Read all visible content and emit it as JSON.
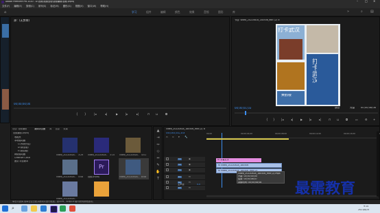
{
  "app": {
    "title": "Adobe Premiere Pro 2020 - D:\\视频\\视频处理\\视频编辑\\视频.prproj",
    "menu": [
      "文件(F)",
      "编辑(E)",
      "剪辑(C)",
      "序列(S)",
      "标记(M)",
      "图形(G)",
      "视图(V)",
      "窗口(W)",
      "帮助(H)"
    ],
    "workspaces": [
      "学习",
      "组件",
      "编辑",
      "颜色",
      "效果",
      "音频",
      "图形",
      "库"
    ],
    "active_workspace": "学习"
  },
  "source_monitor": {
    "tab": "源：(无剪辑)",
    "timecode": "00;00;00;00"
  },
  "program_monitor": {
    "tab": "节目: video_20220818_180506_edit (2) ≡",
    "timecode_left": "00;00;01;03",
    "fit": "适合",
    "quality": "完整",
    "timecode_right": "00;00;08;08",
    "image": {
      "left_text": "打卡武汉",
      "right_text": "打卡武汉",
      "bottom_text": "黄鹤楼"
    }
  },
  "project_panel": {
    "tabs": [
      "项目: 视频编辑",
      "媒体浏览器",
      "库",
      "信息",
      "效果"
    ],
    "path": "视频编辑.prproj",
    "tree": [
      "收藏夹",
      "本地驱动器",
      "C:(系统分区)",
      "D:(新加卷)",
      "E:(新加卷)",
      "网络驱动器",
      "Creative Cloud",
      "团队 项目版本"
    ],
    "items": [
      {
        "label": "video_20220818..",
        "dur": "3:29"
      },
      {
        "label": "video_20220818..",
        "dur": "3:15"
      },
      {
        "label": "video_20220818..",
        "dur": "4:01"
      },
      {
        "label": "video_20220818..",
        "dur": "5:08"
      },
      {
        "label": "视频.prproj",
        "dur": ""
      },
      {
        "label": "video_20220818..",
        "dur": "8:08"
      },
      {
        "label": "video_20220818..",
        "dur": ""
      },
      {
        "label": "",
        "dur": ""
      }
    ]
  },
  "timeline": {
    "tab": "video_20220818_180506_edit (2) ≡",
    "timecode": "00;00;01;03",
    "ruler": [
      "00;00",
      "00;00;04;00",
      "00;00;08;00",
      "00;00;12;00",
      "00;00;16;00",
      "00;00;20;00"
    ],
    "tracks": [
      "V3",
      "V2",
      "V1",
      "A1",
      "A2",
      "A3"
    ],
    "clips": {
      "v3": "fx 字幕文字",
      "v2": "fx video_20220818_180506",
      "v1": "fx video_20220818_180506_edit (2)"
    },
    "tooltip": {
      "name": "video_20220818_180506_edit (2).mp4",
      "start": "开始: 00;00;00;00",
      "end": "结束: 00;00;08;07",
      "duration": "持续时间: 00;00;08;08"
    },
    "master": "主声道",
    "master_value": "0.0"
  },
  "status_bar": "单击以选择,或单击空白处并拖动以进行框选。按Shift、Alt和Ctrl键可获得其他选项。",
  "watermark": "最需教育",
  "taskbar": {
    "time": "9:14",
    "date": "2021/8/24",
    "colors": {
      "bg": "#dbe6f1"
    }
  },
  "colors": {
    "accent": "#3d8ef0",
    "pink_clip": "#e58ee0",
    "blue_clip": "#a9c1e8",
    "watermark": "#1530a8"
  }
}
